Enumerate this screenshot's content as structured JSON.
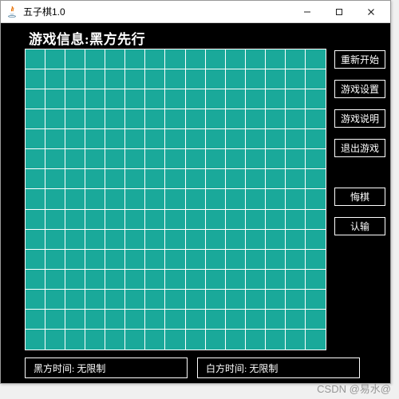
{
  "window": {
    "title": "五子棋1.0"
  },
  "game": {
    "info_label": "游戏信息:黑方先行",
    "board_size": 15
  },
  "buttons": {
    "restart": "重新开始",
    "settings": "游戏设置",
    "instructions": "游戏说明",
    "exit": "退出游戏",
    "undo": "悔棋",
    "resign": "认输"
  },
  "timers": {
    "black_label": "黑方时间:  无限制",
    "white_label": "白方时间:  无限制"
  },
  "watermark": "CSDN @易水@"
}
